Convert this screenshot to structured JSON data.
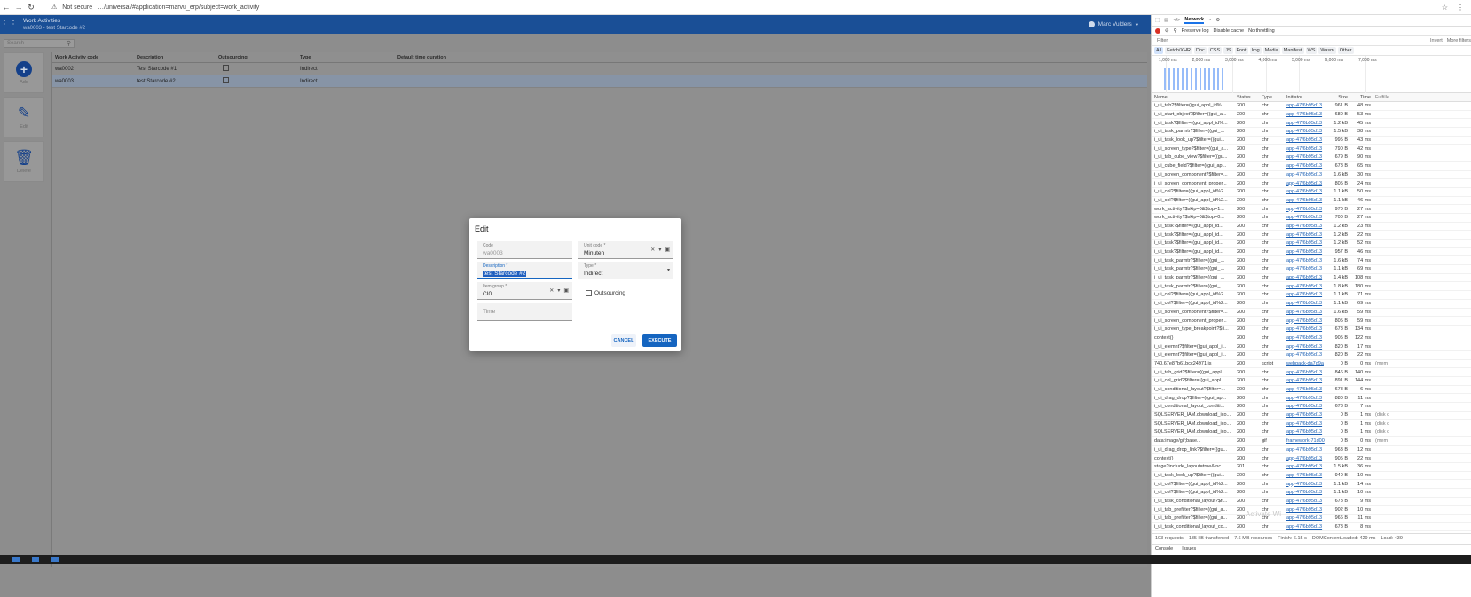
{
  "browser": {
    "security_label": "Not secure",
    "url": "…/universal/#application=marvu_erp/subject=work_activity"
  },
  "header": {
    "title": "Work Activities",
    "subtitle": "wa0003 - test Starcode #2",
    "user_name": "Marc Vulders"
  },
  "search": {
    "placeholder": "Search"
  },
  "sidebar": {
    "items": [
      {
        "label": "Add",
        "icon": "plus-icon"
      },
      {
        "label": "Edit",
        "icon": "pencil-icon"
      },
      {
        "label": "Delete",
        "icon": "trash-icon"
      }
    ]
  },
  "grid": {
    "columns": [
      "Work Activity code",
      "Description",
      "Outsourcing",
      "Type",
      "Default time duration"
    ],
    "rows": [
      {
        "code": "wa0002",
        "description": "Test Starcode #1",
        "outsourcing": false,
        "type": "Indirect",
        "duration": ""
      },
      {
        "code": "wa0003",
        "description": "test Starcode #2",
        "outsourcing": false,
        "type": "Indirect",
        "duration": "",
        "selected": true
      }
    ]
  },
  "dialog": {
    "title": "Edit",
    "code_label": "Code",
    "code_value": "wa0003",
    "unit_label": "Unit code *",
    "unit_value": "Minuten",
    "description_label": "Description *",
    "description_value": "test Starcode #2",
    "type_label": "Type *",
    "type_value": "Indirect",
    "item_group_label": "Item group *",
    "item_group_value": "CI0",
    "time_placeholder": "Time",
    "outsourcing_label": "Outsourcing",
    "cancel_label": "CANCEL",
    "execute_label": "EXECUTE"
  },
  "devtools": {
    "tabs": [
      "Network"
    ],
    "toolbar": {
      "preserve_log": "Preserve log",
      "disable_cache": "Disable cache",
      "throttling": "No throttling"
    },
    "filter_label": "Filter",
    "invert_label": "Invert",
    "more_filters_label": "More filters",
    "type_filters": [
      "All",
      "Fetch/XHR",
      "Doc",
      "CSS",
      "JS",
      "Font",
      "Img",
      "Media",
      "Manifest",
      "WS",
      "Wasm",
      "Other"
    ],
    "timeline_ticks": [
      "1,000 ms",
      "2,000 ms",
      "3,000 ms",
      "4,000 ms",
      "5,000 ms",
      "6,000 ms",
      "7,000 ms"
    ],
    "columns": [
      "Name",
      "Status",
      "Type",
      "Initiator",
      "Size",
      "Time",
      "Fulfille"
    ],
    "rows": [
      [
        "i_ui_tab?$filter=((gui_appl_id%...",
        "200",
        "xhr",
        "app-47f6b95d13",
        "961 B",
        "48 ms",
        ""
      ],
      [
        "i_ui_start_object?$filter=((gui_a...",
        "200",
        "xhr",
        "app-47f6b95d13",
        "680 B",
        "53 ms",
        ""
      ],
      [
        "i_ui_task?$filter=((gui_appl_id%...",
        "200",
        "xhr",
        "app-47f6b95d13",
        "1.2 kB",
        "45 ms",
        ""
      ],
      [
        "i_ui_task_parmtr?$filter=((gui_...",
        "200",
        "xhr",
        "app-47f6b95d13",
        "1.5 kB",
        "38 ms",
        ""
      ],
      [
        "i_ui_task_look_up?$filter=((gui...",
        "200",
        "xhr",
        "app-47f6b95d13",
        "995 B",
        "43 ms",
        ""
      ],
      [
        "i_ui_screen_type?$filter=((gui_a...",
        "200",
        "xhr",
        "app-47f6b95d13",
        "790 B",
        "42 ms",
        ""
      ],
      [
        "i_ui_tab_cube_view?$filter=((gu...",
        "200",
        "xhr",
        "app-47f6b95d13",
        "679 B",
        "90 ms",
        ""
      ],
      [
        "i_ui_cube_field?$filter=((gui_ap...",
        "200",
        "xhr",
        "app-47f6b95d13",
        "678 B",
        "65 ms",
        ""
      ],
      [
        "i_ui_screen_component?$filter=...",
        "200",
        "xhr",
        "app-47f6b95d13",
        "1.6 kB",
        "30 ms",
        ""
      ],
      [
        "i_ui_screen_component_proper...",
        "200",
        "xhr",
        "app-47f6b95d13",
        "805 B",
        "24 ms",
        ""
      ],
      [
        "i_ui_col?$filter=((gui_appl_id%2...",
        "200",
        "xhr",
        "app-47f6b95d13",
        "1.1 kB",
        "50 ms",
        ""
      ],
      [
        "i_ui_col?$filter=((gui_appl_id%2...",
        "200",
        "xhr",
        "app-47f6b95d13",
        "1.1 kB",
        "46 ms",
        ""
      ],
      [
        "work_activity?$skip=0&$top=1...",
        "200",
        "xhr",
        "app-47f6b95d13",
        "970 B",
        "27 ms",
        ""
      ],
      [
        "work_activity?$skip=0&$top=0...",
        "200",
        "xhr",
        "app-47f6b95d13",
        "700 B",
        "27 ms",
        ""
      ],
      [
        "i_ui_task?$filter=((gui_appl_id...",
        "200",
        "xhr",
        "app-47f6b95d13",
        "1.2 kB",
        "23 ms",
        ""
      ],
      [
        "i_ui_task?$filter=((gui_appl_id...",
        "200",
        "xhr",
        "app-47f6b95d13",
        "1.2 kB",
        "22 ms",
        ""
      ],
      [
        "i_ui_task?$filter=((gui_appl_id...",
        "200",
        "xhr",
        "app-47f6b95d13",
        "1.2 kB",
        "52 ms",
        ""
      ],
      [
        "i_ui_task?$filter=((gui_appl_id...",
        "200",
        "xhr",
        "app-47f6b95d13",
        "957 B",
        "46 ms",
        ""
      ],
      [
        "i_ui_task_parmtr?$filter=((gui_...",
        "200",
        "xhr",
        "app-47f6b95d13",
        "1.6 kB",
        "74 ms",
        ""
      ],
      [
        "i_ui_task_parmtr?$filter=((gui_...",
        "200",
        "xhr",
        "app-47f6b95d13",
        "1.1 kB",
        "69 ms",
        ""
      ],
      [
        "i_ui_task_parmtr?$filter=((gui_...",
        "200",
        "xhr",
        "app-47f6b95d13",
        "1.4 kB",
        "108 ms",
        ""
      ],
      [
        "i_ui_task_parmtr?$filter=((gui_...",
        "200",
        "xhr",
        "app-47f6b95d13",
        "1.8 kB",
        "180 ms",
        ""
      ],
      [
        "i_ui_col?$filter=((gui_appl_id%2...",
        "200",
        "xhr",
        "app-47f6b95d13",
        "1.1 kB",
        "71 ms",
        ""
      ],
      [
        "i_ui_col?$filter=((gui_appl_id%2...",
        "200",
        "xhr",
        "app-47f6b95d13",
        "1.1 kB",
        "69 ms",
        ""
      ],
      [
        "i_ui_screen_component?$filter=...",
        "200",
        "xhr",
        "app-47f6b95d13",
        "1.6 kB",
        "59 ms",
        ""
      ],
      [
        "i_ui_screen_component_proper...",
        "200",
        "xhr",
        "app-47f6b95d13",
        "805 B",
        "59 ms",
        ""
      ],
      [
        "i_ui_screen_type_breakpoint?$fi...",
        "200",
        "xhr",
        "app-47f6b95d13",
        "678 B",
        "134 ms",
        ""
      ],
      [
        "context()",
        "200",
        "xhr",
        "app-47f6b95d13",
        "905 B",
        "122 ms",
        ""
      ],
      [
        "i_ui_elemnt?$filter=((gui_appl_i...",
        "200",
        "xhr",
        "app-47f6b95d13",
        "820 B",
        "17 ms",
        ""
      ],
      [
        "i_ui_elemnt?$filter=((gui_appl_i...",
        "200",
        "xhr",
        "app-47f6b95d13",
        "820 B",
        "22 ms",
        ""
      ],
      [
        "740.67e87b61bcc24971.js",
        "200",
        "script",
        "webpack-da7d9a",
        "0 B",
        "0 ms",
        "(mem"
      ],
      [
        "i_ui_tab_grid?$filter=((gui_appl...",
        "200",
        "xhr",
        "app-47f6b95d13",
        "846 B",
        "140 ms",
        ""
      ],
      [
        "i_ui_col_grid?$filter=((gui_appl...",
        "200",
        "xhr",
        "app-47f6b95d13",
        "891 B",
        "144 ms",
        ""
      ],
      [
        "i_ui_conditional_layout?$filter=...",
        "200",
        "xhr",
        "app-47f6b95d13",
        "678 B",
        "6 ms",
        ""
      ],
      [
        "i_ui_drag_drop?$filter=((gui_ap...",
        "200",
        "xhr",
        "app-47f6b95d13",
        "880 B",
        "11 ms",
        ""
      ],
      [
        "i_ui_conditional_layout_conditi...",
        "200",
        "xhr",
        "app-47f6b95d13",
        "678 B",
        "7 ms",
        ""
      ],
      [
        "SQLSERVER_IAM.download_ico...",
        "200",
        "xhr",
        "app-47f6b95d13",
        "0 B",
        "1 ms",
        "(disk c"
      ],
      [
        "SQLSERVER_IAM.download_ico...",
        "200",
        "xhr",
        "app-47f6b95d13",
        "0 B",
        "1 ms",
        "(disk c"
      ],
      [
        "SQLSERVER_IAM.download_ico...",
        "200",
        "xhr",
        "app-47f6b95d13",
        "0 B",
        "1 ms",
        "(disk c"
      ],
      [
        "data:image/gif;base...",
        "200",
        "gif",
        "framework-71d00",
        "0 B",
        "0 ms",
        "(mem"
      ],
      [
        "i_ui_drag_drop_link?$filter=((gu...",
        "200",
        "xhr",
        "app-47f6b95d13",
        "963 B",
        "12 ms",
        ""
      ],
      [
        "context()",
        "200",
        "xhr",
        "app-47f6b95d13",
        "905 B",
        "22 ms",
        ""
      ],
      [
        "stage?include_layout=true&inc...",
        "201",
        "xhr",
        "app-47f6b95d13",
        "1.5 kB",
        "36 ms",
        ""
      ],
      [
        "i_ui_task_look_up?$filter=((gui...",
        "200",
        "xhr",
        "app-47f6b95d13",
        "940 B",
        "10 ms",
        ""
      ],
      [
        "i_ui_col?$filter=((gui_appl_id%2...",
        "200",
        "xhr",
        "app-47f6b95d13",
        "1.1 kB",
        "14 ms",
        ""
      ],
      [
        "i_ui_col?$filter=((gui_appl_id%2...",
        "200",
        "xhr",
        "app-47f6b95d13",
        "1.1 kB",
        "10 ms",
        ""
      ],
      [
        "i_ui_task_conditional_layout?$fi...",
        "200",
        "xhr",
        "app-47f6b95d13",
        "678 B",
        "9 ms",
        ""
      ],
      [
        "i_ui_tab_prefilter?$filter=((gui_a...",
        "200",
        "xhr",
        "app-47f6b95d13",
        "902 B",
        "10 ms",
        ""
      ],
      [
        "i_ui_tab_prefilter?$filter=((gui_a...",
        "200",
        "xhr",
        "app-47f6b95d13",
        "966 B",
        "11 ms",
        ""
      ],
      [
        "i_ui_task_conditional_layout_co...",
        "200",
        "xhr",
        "app-47f6b95d13",
        "678 B",
        "8 ms",
        ""
      ]
    ],
    "status_bar": [
      "103 requests",
      "135 kB transferred",
      "7.6 MB resources",
      "Finish: 6.15 s",
      "DOMContentLoaded: 429 ms",
      "Load: 439"
    ],
    "bottom_tabs": [
      "Console",
      "Issues"
    ],
    "watermark": "Activate Wi"
  },
  "colors": {
    "header": "#1a4f96",
    "accent": "#1565c0",
    "overlay": "#8d8d8d"
  }
}
